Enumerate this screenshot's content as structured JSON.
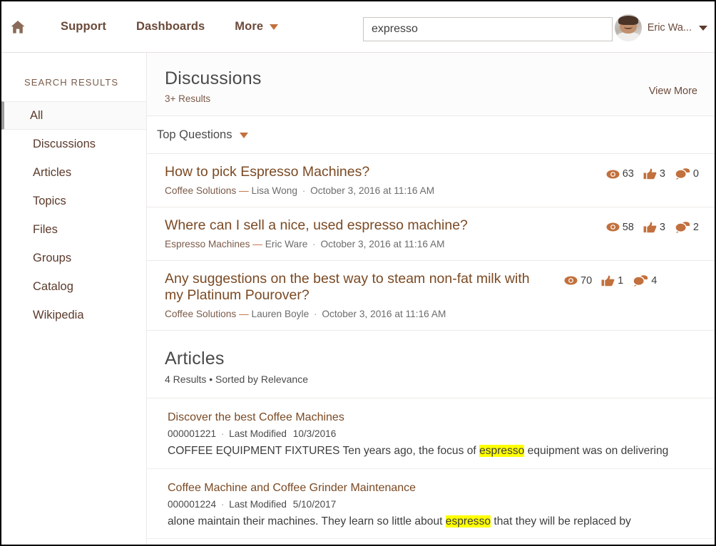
{
  "header": {
    "home_icon": "home-icon",
    "nav": [
      {
        "label": "Support",
        "icon": null
      },
      {
        "label": "Dashboards",
        "icon": null
      },
      {
        "label": "More",
        "icon": "caret-down-icon"
      }
    ],
    "search": {
      "value": "expresso",
      "placeholder": "Search...",
      "icon": "search-input"
    },
    "user": {
      "name": "Eric Wa...",
      "avatar": "user-avatar",
      "caret": "caret-down-icon"
    }
  },
  "sidebar": {
    "title": "SEARCH RESULTS",
    "items": [
      {
        "label": "All",
        "active": true
      },
      {
        "label": "Discussions",
        "active": false
      },
      {
        "label": "Articles",
        "active": false
      },
      {
        "label": "Topics",
        "active": false
      },
      {
        "label": "Files",
        "active": false
      },
      {
        "label": "Groups",
        "active": false
      },
      {
        "label": "Catalog",
        "active": false
      },
      {
        "label": "Wikipedia",
        "active": false
      }
    ]
  },
  "main": {
    "discussions": {
      "title": "Discussions",
      "results": "3+ Results",
      "view_more": "View More",
      "sort": {
        "label": "Top Questions",
        "icon": "caret-down-icon"
      },
      "items": [
        {
          "title": "How to pick Espresso Machines?",
          "group": "Coffee Solutions",
          "dash": "—",
          "author": "Lisa Wong",
          "separator": "·",
          "date": "October 3, 2016 at 11:16 AM",
          "views": "63",
          "likes": "3",
          "comments": "0"
        },
        {
          "title": "Where can I sell a nice, used espresso machine?",
          "group": "Espresso Machines",
          "dash": "—",
          "author": "Eric Ware",
          "separator": "·",
          "date": "October 3, 2016 at 11:16 AM",
          "views": "58",
          "likes": "3",
          "comments": "2"
        },
        {
          "title": "Any suggestions on the best way to steam non-fat milk with my Platinum Pourover?",
          "group": "Coffee Solutions",
          "dash": "—",
          "author": "Lauren Boyle",
          "separator": "·",
          "date": "October 3, 2016 at 11:16 AM",
          "views": "70",
          "likes": "1",
          "comments": "4"
        }
      ]
    },
    "articles": {
      "title": "Articles",
      "results": "4 Results • Sorted by Relevance",
      "items": [
        {
          "title": "Discover the best Coffee Machines",
          "number": "000001221",
          "separator": "·",
          "modified_label": "Last Modified",
          "modified_date": "10/3/2016",
          "snippet_before": "COFFEE EQUIPMENT FIXTURES Ten years ago, the focus of ",
          "snippet_highlight": "espresso",
          "snippet_after": " equipment was on delivering"
        },
        {
          "title": "Coffee Machine and Coffee Grinder Maintenance",
          "number": "000001224",
          "separator": "·",
          "modified_label": "Last Modified",
          "modified_date": "5/10/2017",
          "snippet_before": "alone maintain their machines. They learn so little about ",
          "snippet_highlight": "espresso",
          "snippet_after": " that they will be replaced by"
        }
      ]
    }
  },
  "colors": {
    "brand_brown": "#6b4a3a",
    "accent_orange": "#c2703d",
    "link_brown": "#7b4a24",
    "highlight_yellow": "#ffff00",
    "active_border": "#9c9c9c"
  }
}
